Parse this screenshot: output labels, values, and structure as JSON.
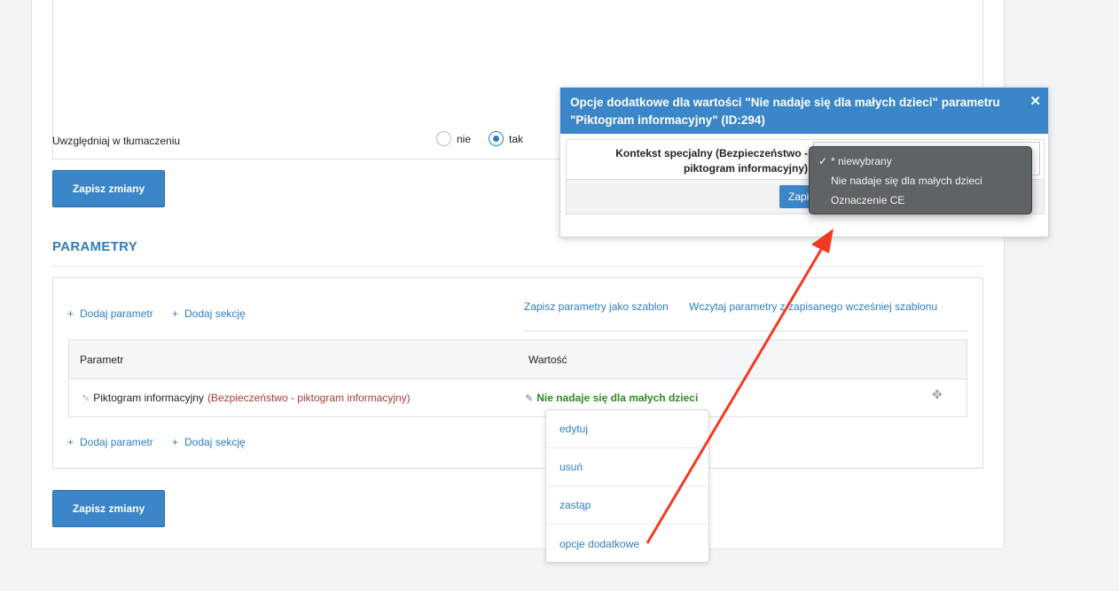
{
  "form": {
    "translate_label": "Uwzględniaj w tłumaczeniu",
    "radio_no": "nie",
    "radio_yes": "tak",
    "save_button": "Zapisz zmiany"
  },
  "params": {
    "section_title": "PARAMETRY",
    "add_param": "Dodaj parametr",
    "add_section": "Dodaj sekcję",
    "save_template": "Zapisz parametry jako szablon",
    "load_template": "Wczytaj parametry z zapisanego wcześniej szablonu",
    "col_param": "Parametr",
    "col_value": "Wartość",
    "row": {
      "name": "Piktogram informacyjny",
      "context": "(Bezpieczeństwo - piktogram informacyjny)",
      "value": "Nie nadaje się dla małych dzieci"
    },
    "save_button": "Zapisz zmiany"
  },
  "context_menu": [
    "edytuj",
    "usuń",
    "zastąp",
    "opcje dodatkowe"
  ],
  "modal": {
    "title": "Opcje dodatkowe dla wartości \"Nie nadaje się dla małych dzieci\" parametru \"Piktogram informacyjny\" (ID:294)",
    "label": "Kontekst specjalny (Bezpieczeństwo - piktogram informacyjny)",
    "save_button": "Zapi"
  },
  "dropdown": {
    "options": [
      "* niewybrany",
      "Nie nadaje się dla małych dzieci",
      "Oznaczenie CE"
    ],
    "selected_index": 0
  },
  "colors": {
    "accent": "#3a86c8",
    "value_green": "#2e8b22",
    "context_red": "#a83a3a",
    "arrow": "#f23a22"
  }
}
